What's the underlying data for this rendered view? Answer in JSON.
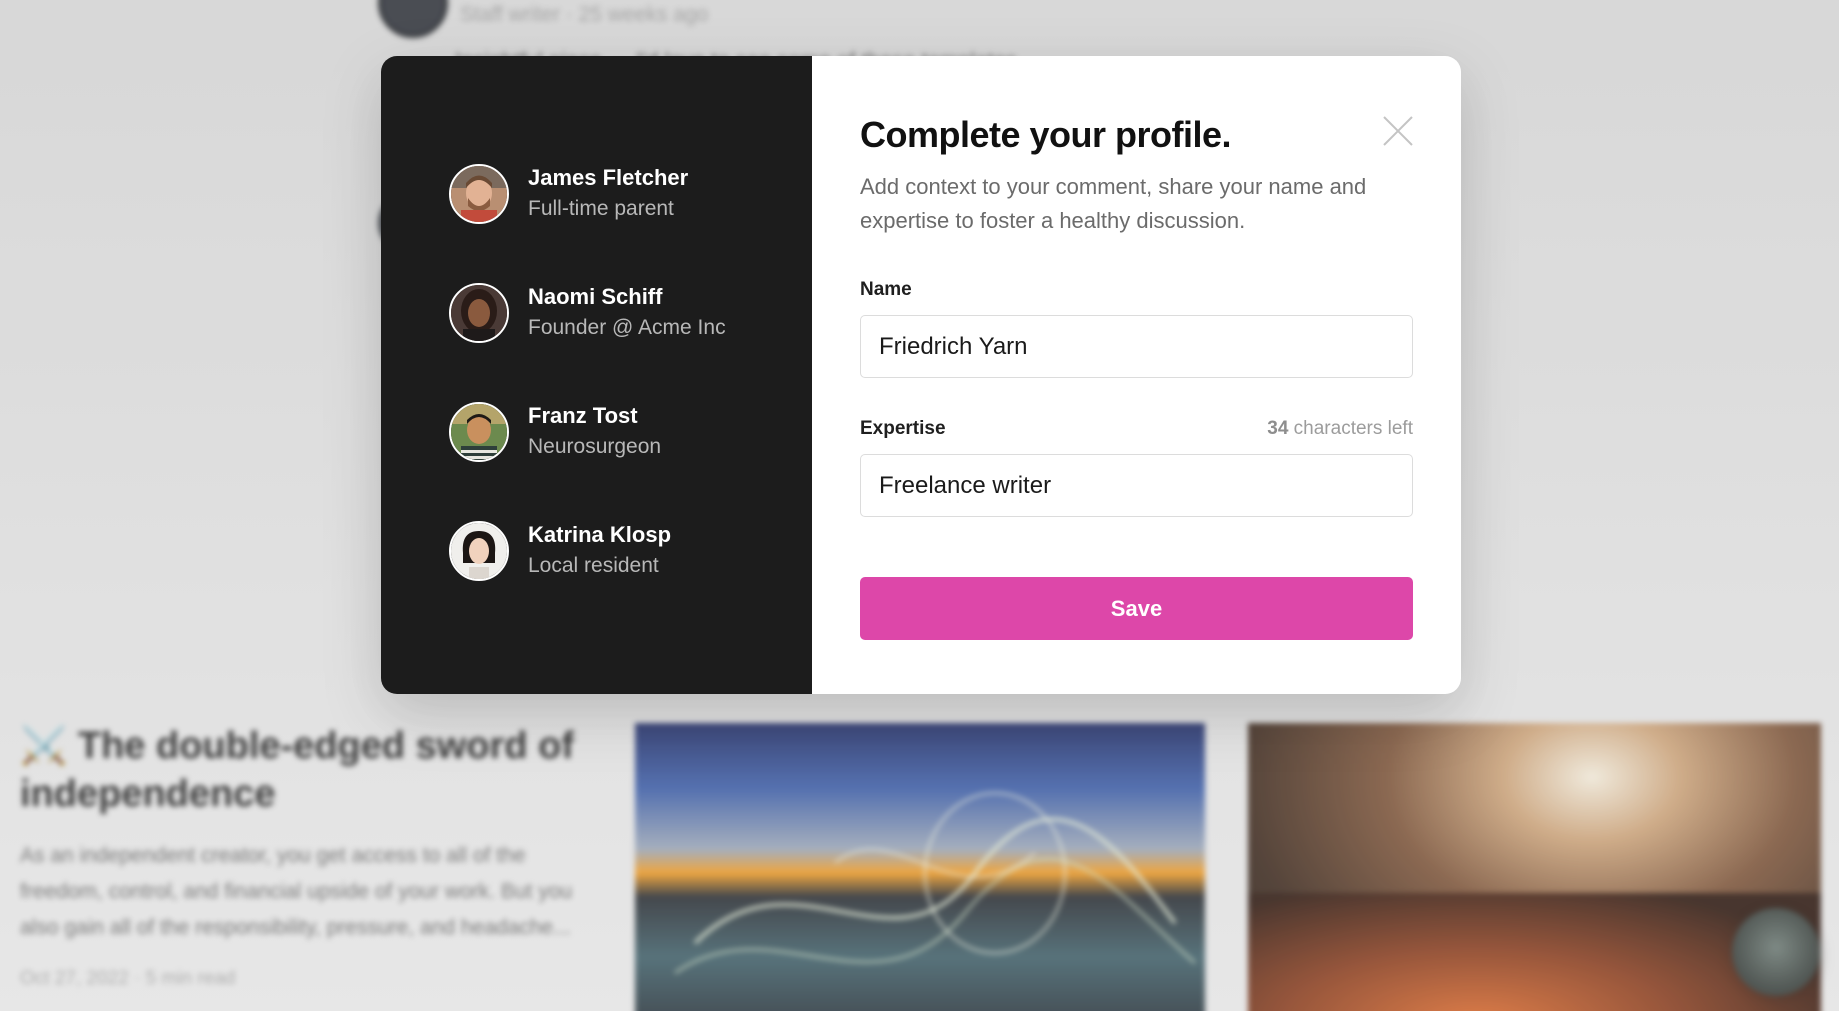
{
  "background": {
    "top_meta": "Staff writer · 25 weeks ago",
    "top_comment": "Insightful piece — I'd love to see some of these templates",
    "article": {
      "title": "⚔️ The double-edged sword of independence",
      "excerpt": "As an independent creator, you get access to all of the freedom, control, and financial upside of your work. But you also gain all of the responsibility, pressure, and headache...",
      "meta": "Oct 27, 2022 · 5 min read"
    }
  },
  "modal": {
    "people": [
      {
        "name": "James Fletcher",
        "role": "Full-time parent"
      },
      {
        "name": "Naomi Schiff",
        "role": "Founder @ Acme Inc"
      },
      {
        "name": "Franz Tost",
        "role": "Neurosurgeon"
      },
      {
        "name": "Katrina Klosp",
        "role": "Local resident"
      }
    ],
    "title": "Complete your profile.",
    "description": "Add context to your comment, share your name and expertise to foster a healthy discussion.",
    "name_label": "Name",
    "name_value": "Friedrich Yarn",
    "expertise_label": "Expertise",
    "chars_left_count": "34",
    "chars_left_text": " characters left",
    "expertise_value": "Freelance writer",
    "save_label": "Save"
  },
  "colors": {
    "accent": "#dd47a9",
    "panel_dark": "#1c1c1c"
  },
  "icons": [
    "close-icon",
    "avatar-icon"
  ]
}
